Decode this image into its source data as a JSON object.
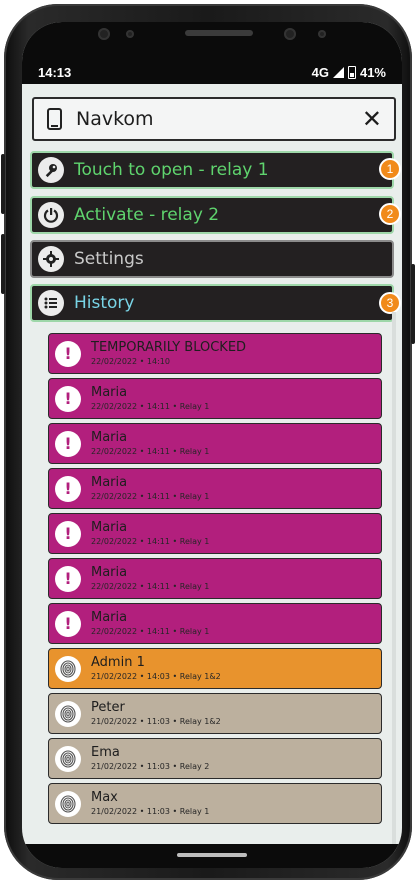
{
  "status_bar": {
    "time": "14:13",
    "network": "4G",
    "battery": "41%"
  },
  "header": {
    "title": "Navkom",
    "device_icon": "smartphone-icon",
    "close_glyph": "✕"
  },
  "menu": [
    {
      "label": "Touch to open - relay 1",
      "icon": "key-icon",
      "color": "#5fd46e",
      "badge": "1"
    },
    {
      "label": "Activate - relay 2",
      "icon": "power-icon",
      "color": "#5fd46e",
      "badge": "2"
    },
    {
      "label": "Settings",
      "icon": "gear-icon",
      "color": "#c9c9c9",
      "badge": ""
    },
    {
      "label": "History",
      "icon": "list-icon",
      "color": "#79d4e6",
      "badge": "3"
    }
  ],
  "history": [
    {
      "type": "blocked",
      "title": "TEMPORARILY BLOCKED",
      "meta": "22/02/2022 • 14:10"
    },
    {
      "type": "blocked",
      "title": "Maria",
      "meta": "22/02/2022 • 14:11 • Relay 1"
    },
    {
      "type": "blocked",
      "title": "Maria",
      "meta": "22/02/2022 • 14:11 • Relay 1"
    },
    {
      "type": "blocked",
      "title": "Maria",
      "meta": "22/02/2022 • 14:11 • Relay 1"
    },
    {
      "type": "blocked",
      "title": "Maria",
      "meta": "22/02/2022 • 14:11 • Relay 1"
    },
    {
      "type": "blocked",
      "title": "Maria",
      "meta": "22/02/2022 • 14:11 • Relay 1"
    },
    {
      "type": "blocked",
      "title": "Maria",
      "meta": "22/02/2022 • 14:11 • Relay 1"
    },
    {
      "type": "admin",
      "title": "Admin 1",
      "meta": "21/02/2022 • 14:03 • Relay 1&2"
    },
    {
      "type": "user",
      "title": "Peter",
      "meta": "21/02/2022 • 11:03 • Relay 1&2"
    },
    {
      "type": "user",
      "title": "Ema",
      "meta": "21/02/2022 • 11:03 • Relay 2"
    },
    {
      "type": "user",
      "title": "Max",
      "meta": "21/02/2022 • 11:03 • Relay 1"
    }
  ],
  "colors": {
    "blocked": "#b21f7d",
    "admin": "#e8932d",
    "user": "#bcb09e",
    "badge": "#f18a1a"
  }
}
